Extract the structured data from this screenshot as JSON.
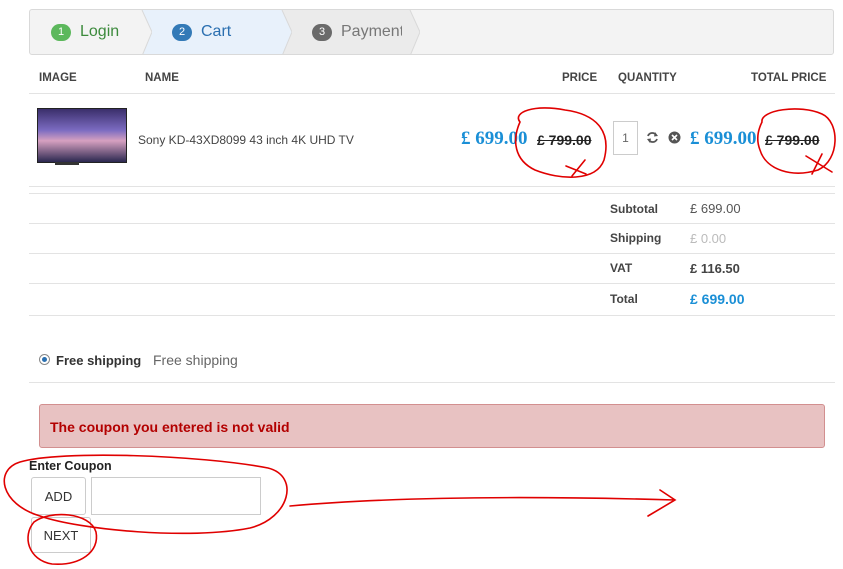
{
  "steps": [
    {
      "num": "1",
      "label": "Login"
    },
    {
      "num": "2",
      "label": "Cart"
    },
    {
      "num": "3",
      "label": "Payment"
    }
  ],
  "table": {
    "headers": {
      "image": "IMAGE",
      "name": "NAME",
      "price": "PRICE",
      "quantity": "QUANTITY",
      "total_price": "TOTAL PRICE"
    }
  },
  "item": {
    "name": "Sony KD-43XD8099 43 inch 4K UHD TV",
    "price_new": "£ 699.00",
    "price_old": "£ 799.00",
    "quantity": "1",
    "total_new": "£ 699.00",
    "total_old": "£ 799.00"
  },
  "totals": [
    {
      "label": "Subtotal",
      "value": "£ 699.00"
    },
    {
      "label": "Shipping",
      "value": "£ 0.00"
    },
    {
      "label": "VAT",
      "value": "£ 116.50"
    },
    {
      "label": "Total",
      "value": "£ 699.00"
    }
  ],
  "shipping": {
    "name": "Free shipping",
    "description": "Free shipping"
  },
  "alert": {
    "message": "The coupon you entered is not valid"
  },
  "coupon": {
    "label": "Enter Coupon",
    "add_label": "ADD",
    "value": ""
  },
  "next_label": "NEXT",
  "colors": {
    "accent": "#1a8fd6",
    "error": "#b30000",
    "annotation": "#e00000"
  },
  "icons": [
    "refresh-icon",
    "remove-icon"
  ]
}
